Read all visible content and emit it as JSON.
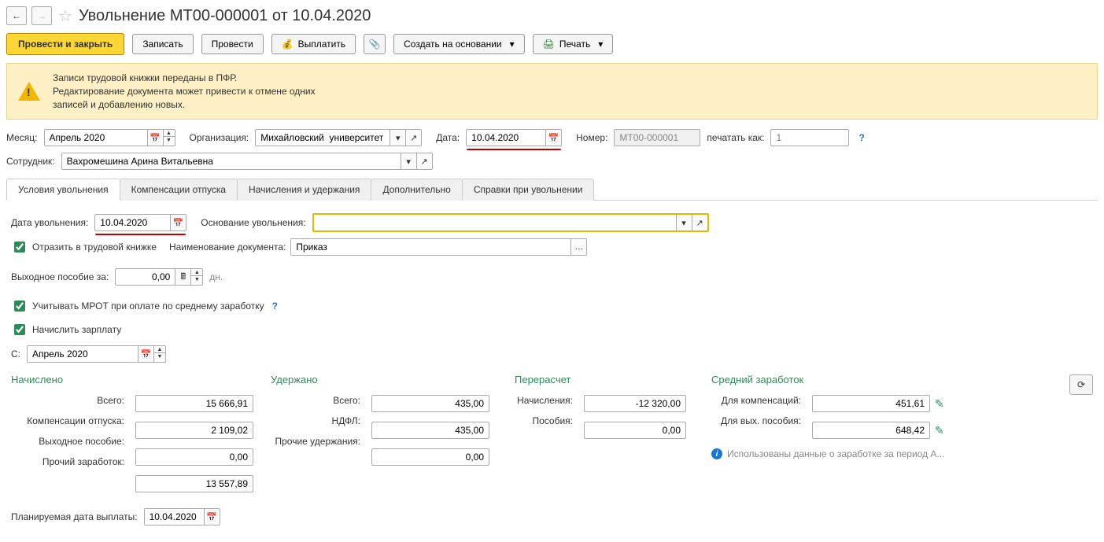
{
  "header": {
    "title": "Увольнение МТ00-000001 от 10.04.2020"
  },
  "toolbar": {
    "post_close": "Провести и закрыть",
    "save": "Записать",
    "post": "Провести",
    "pay": "Выплатить",
    "create_based": "Создать на основании",
    "print": "Печать"
  },
  "warning": {
    "line1": "Записи трудовой книжки переданы в ПФР.",
    "line2": "Редактирование документа может привести к отмене одних",
    "line3": "записей и добавлению новых."
  },
  "form": {
    "month_label": "Месяц:",
    "month": "Апрель 2020",
    "org_label": "Организация:",
    "org": "Михайловский  университет",
    "date_label": "Дата:",
    "date": "10.04.2020",
    "number_label": "Номер:",
    "number": "МТ00-000001",
    "print_as_label": "печатать как:",
    "print_as_placeholder": "1",
    "employee_label": "Сотрудник:",
    "employee": "Вахромешина Арина Витальевна"
  },
  "tabs": {
    "t1": "Условия увольнения",
    "t2": "Компенсации отпуска",
    "t3": "Начисления и удержания",
    "t4": "Дополнительно",
    "t5": "Справки при увольнении"
  },
  "conditions": {
    "dismiss_date_label": "Дата увольнения:",
    "dismiss_date": "10.04.2020",
    "basis_label": "Основание увольнения:",
    "reflect_label": "Отразить в трудовой книжке",
    "doc_name_label": "Наименование документа:",
    "doc_name": "Приказ",
    "severance_label": "Выходное пособие за:",
    "severance_days": "0,00",
    "severance_unit": "дн.",
    "mrot_label": "Учитывать МРОТ при оплате по среднему заработку",
    "accrue_salary_label": "Начислить зарплату",
    "from_label": "С:",
    "from_value": "Апрель 2020"
  },
  "totals": {
    "accrued_title": "Начислено",
    "withheld_title": "Удержано",
    "recalc_title": "Перерасчет",
    "avg_title": "Средний заработок",
    "total_label": "Всего:",
    "accrued_total": "15 666,91",
    "vac_comp_label": "Компенсации отпуска:",
    "vac_comp": "2 109,02",
    "severance_label": "Выходное пособие:",
    "severance": "0,00",
    "other_earn_label": "Прочий заработок:",
    "other_earn": "13 557,89",
    "withheld_total": "435,00",
    "ndfl_label": "НДФЛ:",
    "ndfl": "435,00",
    "other_with_label": "Прочие удержания:",
    "other_with": "0,00",
    "accruals_label": "Начисления:",
    "accruals": "-12 320,00",
    "benefits_label": "Пособия:",
    "benefits": "0,00",
    "for_comp_label": "Для компенсаций:",
    "for_comp": "451,61",
    "for_sev_label": "Для вых. пособия:",
    "for_sev": "648,42",
    "info_text": "Использованы данные о заработке за период А...",
    "planned_date_label": "Планируемая дата выплаты:",
    "planned_date": "10.04.2020"
  }
}
